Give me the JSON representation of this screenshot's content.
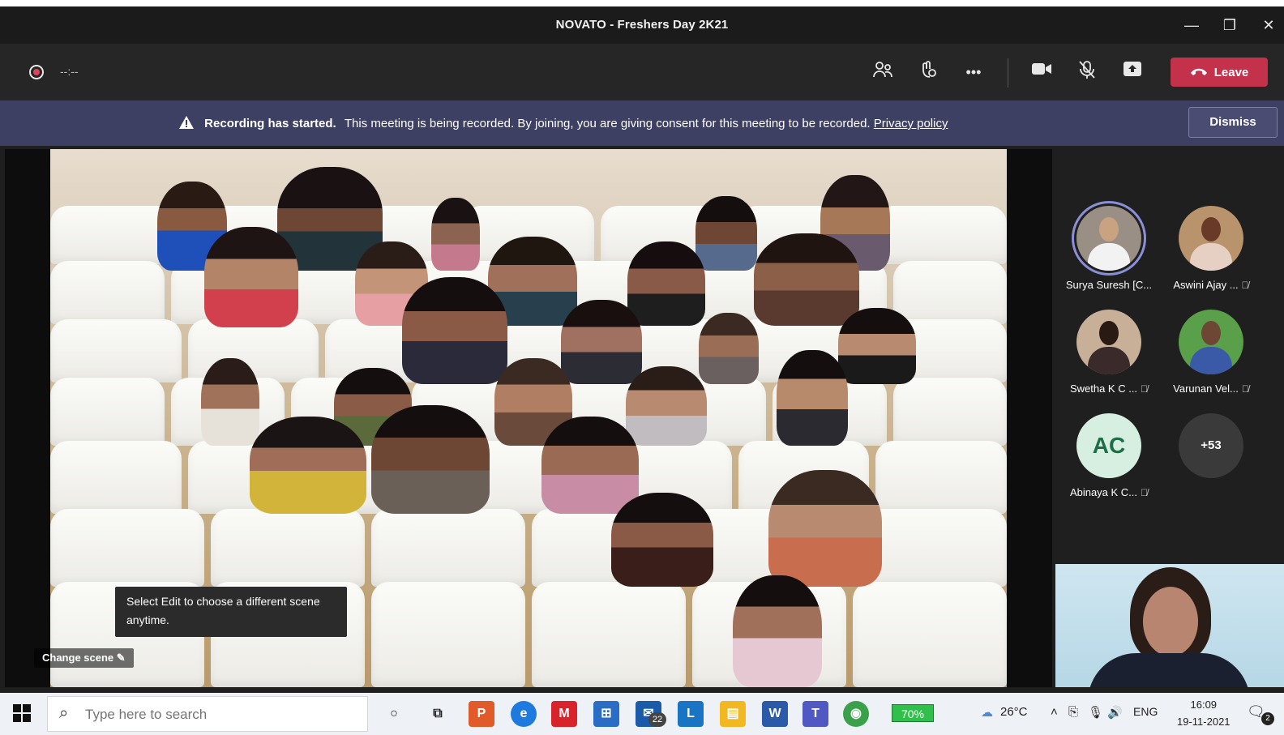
{
  "window": {
    "title": "NOVATO - Freshers Day 2K21"
  },
  "toolbar": {
    "timer": "--:--",
    "leave_label": "Leave",
    "icons": [
      "participants-icon",
      "reactions-icon",
      "more-icon",
      "camera-icon",
      "mic-muted-icon",
      "share-icon",
      "phone-icon"
    ]
  },
  "banner": {
    "title": "Recording has started.",
    "message": "This meeting is being recorded. By joining, you are giving consent for this meeting to be recorded.",
    "link": "Privacy policy",
    "dismiss_label": "Dismiss"
  },
  "stage": {
    "tooltip": "Select Edit to choose a different scene anytime.",
    "change_scene_label": "Change scene"
  },
  "participants": [
    {
      "name": "Surya Suresh [C...",
      "active": true,
      "muted": false
    },
    {
      "name": "Aswini Ajay ...",
      "active": false,
      "muted": true
    },
    {
      "name": "Swetha K C ...",
      "active": false,
      "muted": true
    },
    {
      "name": "Varunan Vel...",
      "active": false,
      "muted": true
    },
    {
      "name": "Abinaya K C...",
      "initials": "AC",
      "muted": true
    },
    {
      "more": "+53"
    }
  ],
  "taskbar": {
    "search_placeholder": "Type here to search",
    "mail_badge": "22",
    "battery": "70%",
    "temperature": "26°C",
    "language": "ENG",
    "time": "16:09",
    "date": "19-11-2021",
    "notification_count": "2"
  },
  "colors": {
    "banner": "#3d3f63",
    "leave": "#c4314b",
    "active_ring": "#8a8fd6"
  }
}
